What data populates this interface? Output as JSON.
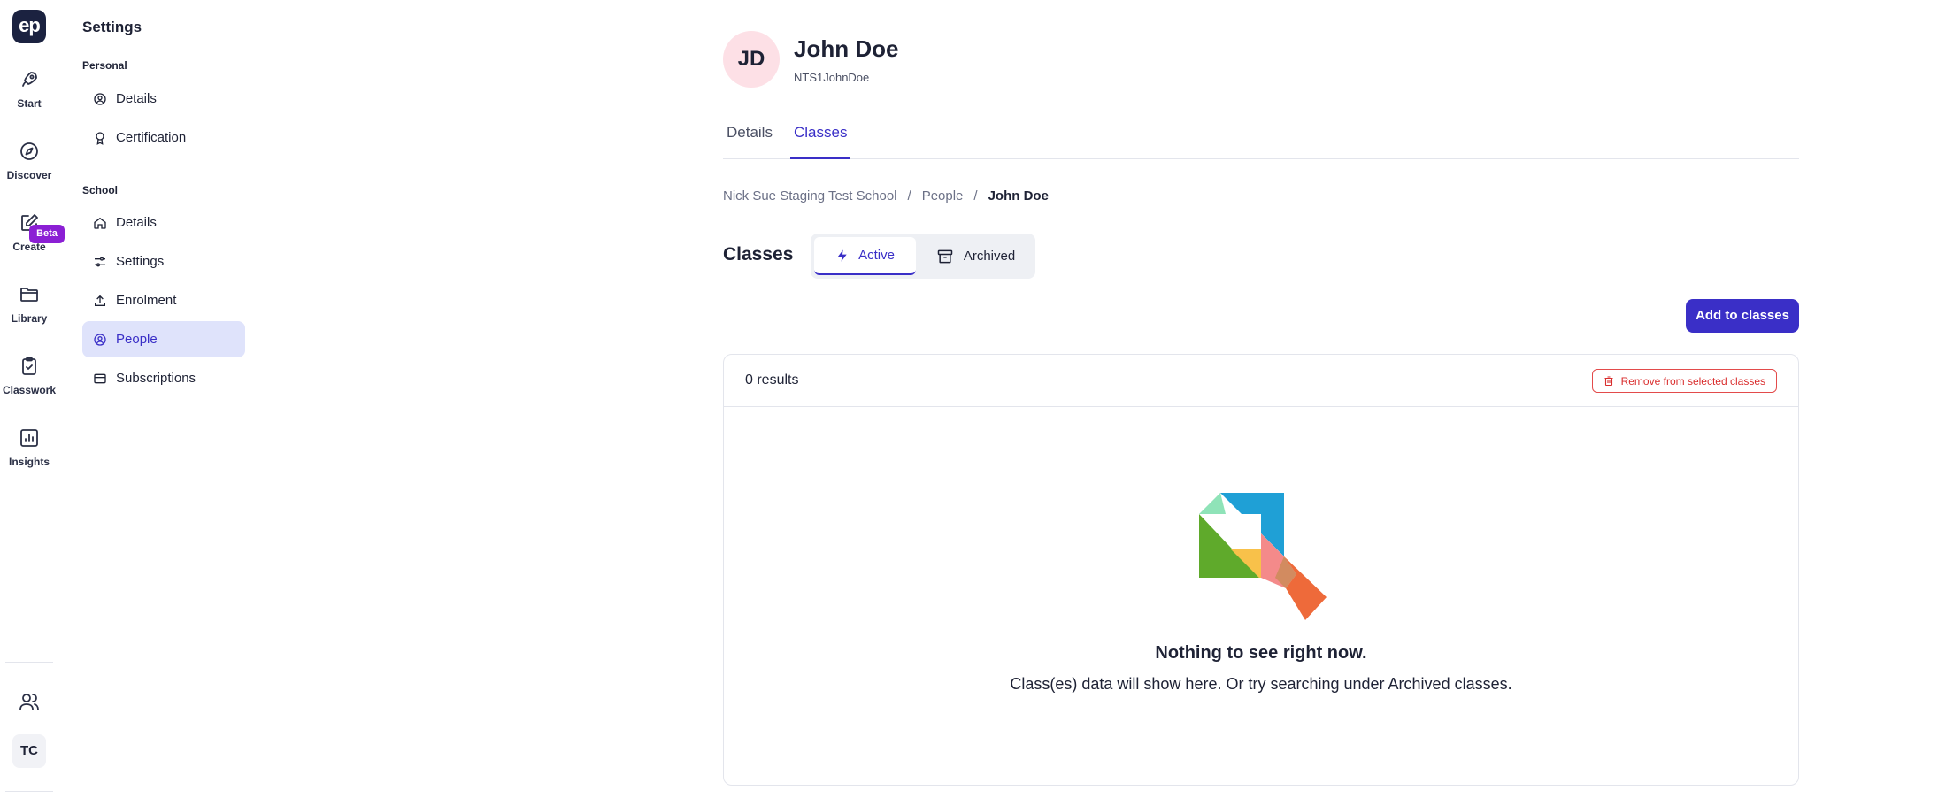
{
  "rail": {
    "logo": "ep",
    "items": [
      {
        "label": "Start",
        "icon": "rocket-icon"
      },
      {
        "label": "Discover",
        "icon": "compass-icon"
      },
      {
        "label": "Create",
        "icon": "edit-icon",
        "badge": "Beta"
      },
      {
        "label": "Library",
        "icon": "folder-icon"
      },
      {
        "label": "Classwork",
        "icon": "clipboard-check-icon"
      },
      {
        "label": "Insights",
        "icon": "bar-chart-icon"
      }
    ],
    "bottom": {
      "people_icon": "users-icon",
      "user_initials": "TC"
    }
  },
  "sidebar": {
    "title": "Settings",
    "personal_label": "Personal",
    "personal_items": [
      {
        "label": "Details",
        "icon": "user-circle-icon"
      },
      {
        "label": "Certification",
        "icon": "award-icon"
      }
    ],
    "school_label": "School",
    "school_items": [
      {
        "label": "Details",
        "icon": "home-icon"
      },
      {
        "label": "Settings",
        "icon": "sliders-icon"
      },
      {
        "label": "Enrolment",
        "icon": "upload-icon"
      },
      {
        "label": "People",
        "icon": "user-circle-icon",
        "active": true
      },
      {
        "label": "Subscriptions",
        "icon": "card-icon"
      }
    ]
  },
  "profile": {
    "initials": "JD",
    "name": "John Doe",
    "handle": "NTS1JohnDoe",
    "avatar_color": "#fde0e6"
  },
  "tabs": [
    {
      "label": "Details",
      "active": false
    },
    {
      "label": "Classes",
      "active": true
    }
  ],
  "breadcrumb": [
    "Nick Sue Staging Test School",
    "People",
    "John Doe"
  ],
  "classes": {
    "heading": "Classes",
    "segments": [
      {
        "label": "Active",
        "icon": "bolt-icon",
        "active": true
      },
      {
        "label": "Archived",
        "icon": "archive-icon",
        "active": false
      }
    ],
    "add_button": "Add to classes",
    "results_count": "0 results",
    "remove_button": "Remove from selected classes",
    "empty_title": "Nothing to see right now.",
    "empty_subtitle": "Class(es) data will show here. Or try searching under Archived classes."
  },
  "colors": {
    "accent": "#3a2fc7",
    "danger": "#d92d2d",
    "beta_badge": "#8b1fd4",
    "active_nav_bg": "#dfe3fb"
  }
}
